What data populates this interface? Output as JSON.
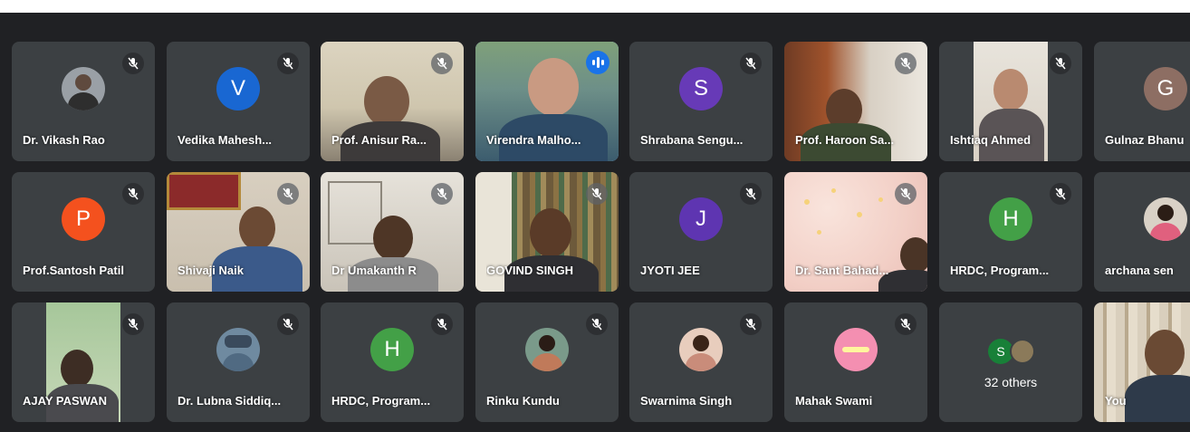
{
  "colors": {
    "background": "#202124",
    "tile": "#3c4043",
    "speaking_outline": "#8ab4f8",
    "speaking_badge": "#1a73e8"
  },
  "participants": [
    {
      "name": "Dr. Vikash Rao",
      "kind": "photo-avatar",
      "muted": true
    },
    {
      "name": "Vedika Mahesh...",
      "kind": "initial",
      "initial": "V",
      "color": "#1967d2",
      "muted": true
    },
    {
      "name": "Prof. Anisur Ra...",
      "kind": "video",
      "muted": true
    },
    {
      "name": "Virendra Malho...",
      "kind": "video",
      "speaking": true
    },
    {
      "name": "Shrabana Sengu...",
      "kind": "initial",
      "initial": "S",
      "color": "#673ab7",
      "muted": true
    },
    {
      "name": "Prof. Haroon Sa...",
      "kind": "video",
      "muted": true
    },
    {
      "name": "Ishtiaq Ahmed",
      "kind": "video",
      "muted": true
    },
    {
      "name": "Gulnaz Bhanu",
      "kind": "initial",
      "initial": "G",
      "color": "#8d6e63",
      "muted": false
    },
    {
      "name": "Prof.Santosh Patil",
      "kind": "initial",
      "initial": "P",
      "color": "#f4511e",
      "muted": true
    },
    {
      "name": "Shivaji Naik",
      "kind": "video",
      "muted": true
    },
    {
      "name": "Dr Umakanth R",
      "kind": "video",
      "muted": true
    },
    {
      "name": "GOVIND SINGH",
      "kind": "video",
      "muted": true
    },
    {
      "name": "JYOTI JEE",
      "kind": "initial",
      "initial": "J",
      "color": "#5e35b1",
      "muted": true
    },
    {
      "name": "Dr. Sant Bahad...",
      "kind": "video",
      "muted": true
    },
    {
      "name": "HRDC, Program...",
      "kind": "initial",
      "initial": "H",
      "color": "#43a047",
      "muted": true
    },
    {
      "name": "archana sen",
      "kind": "photo-avatar",
      "muted": false
    },
    {
      "name": "AJAY PASWAN",
      "kind": "video",
      "muted": true
    },
    {
      "name": "Dr. Lubna Siddiq...",
      "kind": "photo-avatar",
      "muted": false
    },
    {
      "name": "HRDC, Program...",
      "kind": "initial",
      "initial": "H",
      "color": "#43a047",
      "muted": true
    },
    {
      "name": "Rinku Kundu",
      "kind": "photo-avatar",
      "muted": true
    },
    {
      "name": "Swarnima Singh",
      "kind": "photo-avatar",
      "muted": true
    },
    {
      "name": "Mahak Swami",
      "kind": "photo-avatar",
      "muted": true
    },
    {
      "name": "32 others",
      "kind": "others",
      "initial": "S"
    },
    {
      "name": "You",
      "kind": "video",
      "muted": false
    }
  ]
}
